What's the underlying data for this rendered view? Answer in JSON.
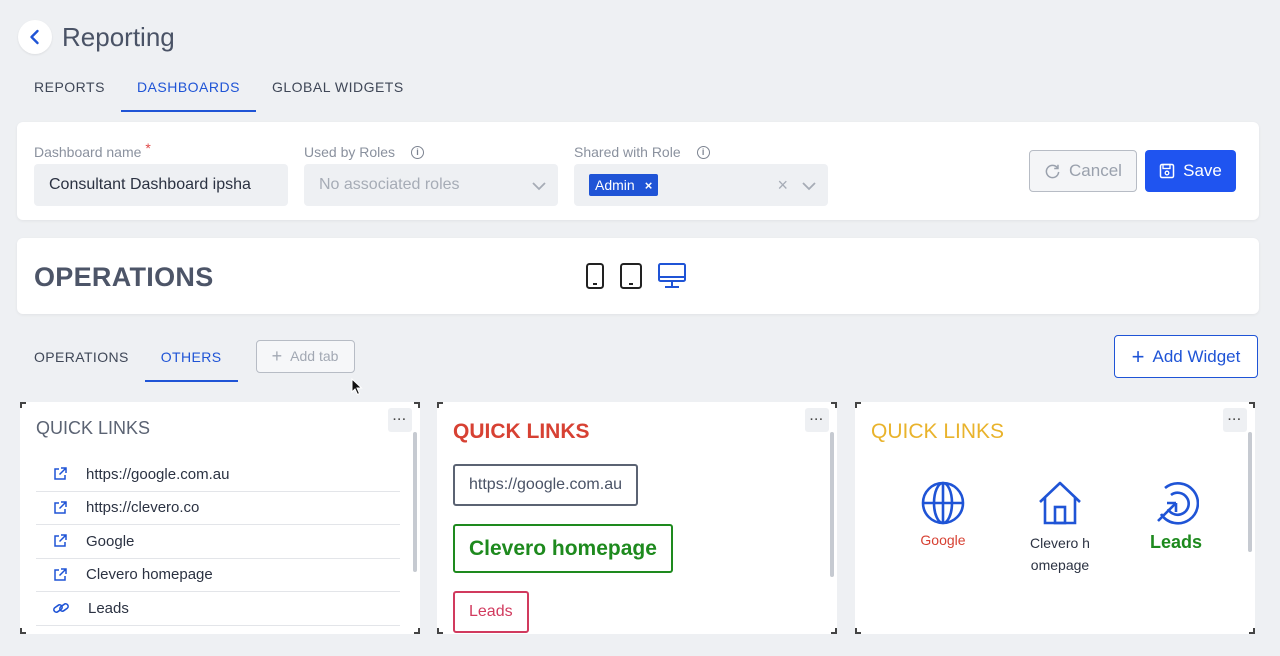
{
  "header": {
    "title": "Reporting"
  },
  "main_tabs": [
    {
      "label": "REPORTS"
    },
    {
      "label": "DASHBOARDS",
      "active": true
    },
    {
      "label": "GLOBAL WIDGETS"
    }
  ],
  "settings": {
    "dashboard_name": {
      "label": "Dashboard name",
      "required_mark": "*",
      "value": "Consultant Dashboard ipsha"
    },
    "used_by_roles": {
      "label": "Used by Roles",
      "placeholder": "No associated roles"
    },
    "shared_with_role": {
      "label": "Shared with Role",
      "tag": "Admin",
      "tag_remove": "×",
      "clear": "×"
    },
    "cancel_label": "Cancel",
    "save_label": "Save"
  },
  "operations": {
    "title": "OPERATIONS"
  },
  "sub_tabs": [
    {
      "label": "OPERATIONS"
    },
    {
      "label": "OTHERS",
      "active": true
    }
  ],
  "add_tab_label": "Add tab",
  "add_widget_label": "Add Widget",
  "widgets": [
    {
      "title": "QUICK LINKS",
      "menu": "···",
      "links": [
        {
          "label": "https://google.com.au",
          "icon": "external-link-icon"
        },
        {
          "label": "https://clevero.co",
          "icon": "external-link-icon"
        },
        {
          "label": "Google",
          "icon": "external-link-icon"
        },
        {
          "label": "Clevero homepage",
          "icon": "external-link-icon"
        },
        {
          "label": "Leads",
          "icon": "chain-link-icon"
        }
      ]
    },
    {
      "title": "QUICK LINKS",
      "menu": "···",
      "buttons": [
        {
          "label": "https://google.com.au"
        },
        {
          "label": "Clevero homepage"
        },
        {
          "label": "Leads"
        }
      ]
    },
    {
      "title": "QUICK LINKS",
      "menu": "···",
      "tiles": [
        {
          "label": "Google",
          "icon": "globe-icon"
        },
        {
          "label": "Clevero homepage",
          "icon": "home-icon"
        },
        {
          "label": "Leads",
          "icon": "target-pointer-icon"
        }
      ]
    }
  ],
  "colors": {
    "accent": "#1f54d6",
    "save": "#1f54f0",
    "red": "#d74133",
    "green": "#1e8a1e",
    "yellow": "#e9b32c",
    "pink": "#d13a5e"
  }
}
